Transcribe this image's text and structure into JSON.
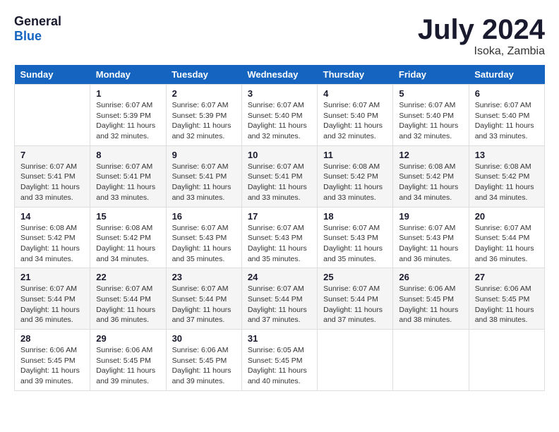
{
  "header": {
    "logo_text_general": "General",
    "logo_text_blue": "Blue",
    "title": "July 2024",
    "subtitle": "Isoka, Zambia"
  },
  "days_of_week": [
    "Sunday",
    "Monday",
    "Tuesday",
    "Wednesday",
    "Thursday",
    "Friday",
    "Saturday"
  ],
  "weeks": [
    [
      {
        "day": "",
        "info": ""
      },
      {
        "day": "1",
        "info": "Sunrise: 6:07 AM\nSunset: 5:39 PM\nDaylight: 11 hours\nand 32 minutes."
      },
      {
        "day": "2",
        "info": "Sunrise: 6:07 AM\nSunset: 5:39 PM\nDaylight: 11 hours\nand 32 minutes."
      },
      {
        "day": "3",
        "info": "Sunrise: 6:07 AM\nSunset: 5:40 PM\nDaylight: 11 hours\nand 32 minutes."
      },
      {
        "day": "4",
        "info": "Sunrise: 6:07 AM\nSunset: 5:40 PM\nDaylight: 11 hours\nand 32 minutes."
      },
      {
        "day": "5",
        "info": "Sunrise: 6:07 AM\nSunset: 5:40 PM\nDaylight: 11 hours\nand 32 minutes."
      },
      {
        "day": "6",
        "info": "Sunrise: 6:07 AM\nSunset: 5:40 PM\nDaylight: 11 hours\nand 33 minutes."
      }
    ],
    [
      {
        "day": "7",
        "info": "Sunrise: 6:07 AM\nSunset: 5:41 PM\nDaylight: 11 hours\nand 33 minutes."
      },
      {
        "day": "8",
        "info": "Sunrise: 6:07 AM\nSunset: 5:41 PM\nDaylight: 11 hours\nand 33 minutes."
      },
      {
        "day": "9",
        "info": "Sunrise: 6:07 AM\nSunset: 5:41 PM\nDaylight: 11 hours\nand 33 minutes."
      },
      {
        "day": "10",
        "info": "Sunrise: 6:07 AM\nSunset: 5:41 PM\nDaylight: 11 hours\nand 33 minutes."
      },
      {
        "day": "11",
        "info": "Sunrise: 6:08 AM\nSunset: 5:42 PM\nDaylight: 11 hours\nand 33 minutes."
      },
      {
        "day": "12",
        "info": "Sunrise: 6:08 AM\nSunset: 5:42 PM\nDaylight: 11 hours\nand 34 minutes."
      },
      {
        "day": "13",
        "info": "Sunrise: 6:08 AM\nSunset: 5:42 PM\nDaylight: 11 hours\nand 34 minutes."
      }
    ],
    [
      {
        "day": "14",
        "info": "Sunrise: 6:08 AM\nSunset: 5:42 PM\nDaylight: 11 hours\nand 34 minutes."
      },
      {
        "day": "15",
        "info": "Sunrise: 6:08 AM\nSunset: 5:42 PM\nDaylight: 11 hours\nand 34 minutes."
      },
      {
        "day": "16",
        "info": "Sunrise: 6:07 AM\nSunset: 5:43 PM\nDaylight: 11 hours\nand 35 minutes."
      },
      {
        "day": "17",
        "info": "Sunrise: 6:07 AM\nSunset: 5:43 PM\nDaylight: 11 hours\nand 35 minutes."
      },
      {
        "day": "18",
        "info": "Sunrise: 6:07 AM\nSunset: 5:43 PM\nDaylight: 11 hours\nand 35 minutes."
      },
      {
        "day": "19",
        "info": "Sunrise: 6:07 AM\nSunset: 5:43 PM\nDaylight: 11 hours\nand 36 minutes."
      },
      {
        "day": "20",
        "info": "Sunrise: 6:07 AM\nSunset: 5:44 PM\nDaylight: 11 hours\nand 36 minutes."
      }
    ],
    [
      {
        "day": "21",
        "info": "Sunrise: 6:07 AM\nSunset: 5:44 PM\nDaylight: 11 hours\nand 36 minutes."
      },
      {
        "day": "22",
        "info": "Sunrise: 6:07 AM\nSunset: 5:44 PM\nDaylight: 11 hours\nand 36 minutes."
      },
      {
        "day": "23",
        "info": "Sunrise: 6:07 AM\nSunset: 5:44 PM\nDaylight: 11 hours\nand 37 minutes."
      },
      {
        "day": "24",
        "info": "Sunrise: 6:07 AM\nSunset: 5:44 PM\nDaylight: 11 hours\nand 37 minutes."
      },
      {
        "day": "25",
        "info": "Sunrise: 6:07 AM\nSunset: 5:44 PM\nDaylight: 11 hours\nand 37 minutes."
      },
      {
        "day": "26",
        "info": "Sunrise: 6:06 AM\nSunset: 5:45 PM\nDaylight: 11 hours\nand 38 minutes."
      },
      {
        "day": "27",
        "info": "Sunrise: 6:06 AM\nSunset: 5:45 PM\nDaylight: 11 hours\nand 38 minutes."
      }
    ],
    [
      {
        "day": "28",
        "info": "Sunrise: 6:06 AM\nSunset: 5:45 PM\nDaylight: 11 hours\nand 39 minutes."
      },
      {
        "day": "29",
        "info": "Sunrise: 6:06 AM\nSunset: 5:45 PM\nDaylight: 11 hours\nand 39 minutes."
      },
      {
        "day": "30",
        "info": "Sunrise: 6:06 AM\nSunset: 5:45 PM\nDaylight: 11 hours\nand 39 minutes."
      },
      {
        "day": "31",
        "info": "Sunrise: 6:05 AM\nSunset: 5:45 PM\nDaylight: 11 hours\nand 40 minutes."
      },
      {
        "day": "",
        "info": ""
      },
      {
        "day": "",
        "info": ""
      },
      {
        "day": "",
        "info": ""
      }
    ]
  ]
}
